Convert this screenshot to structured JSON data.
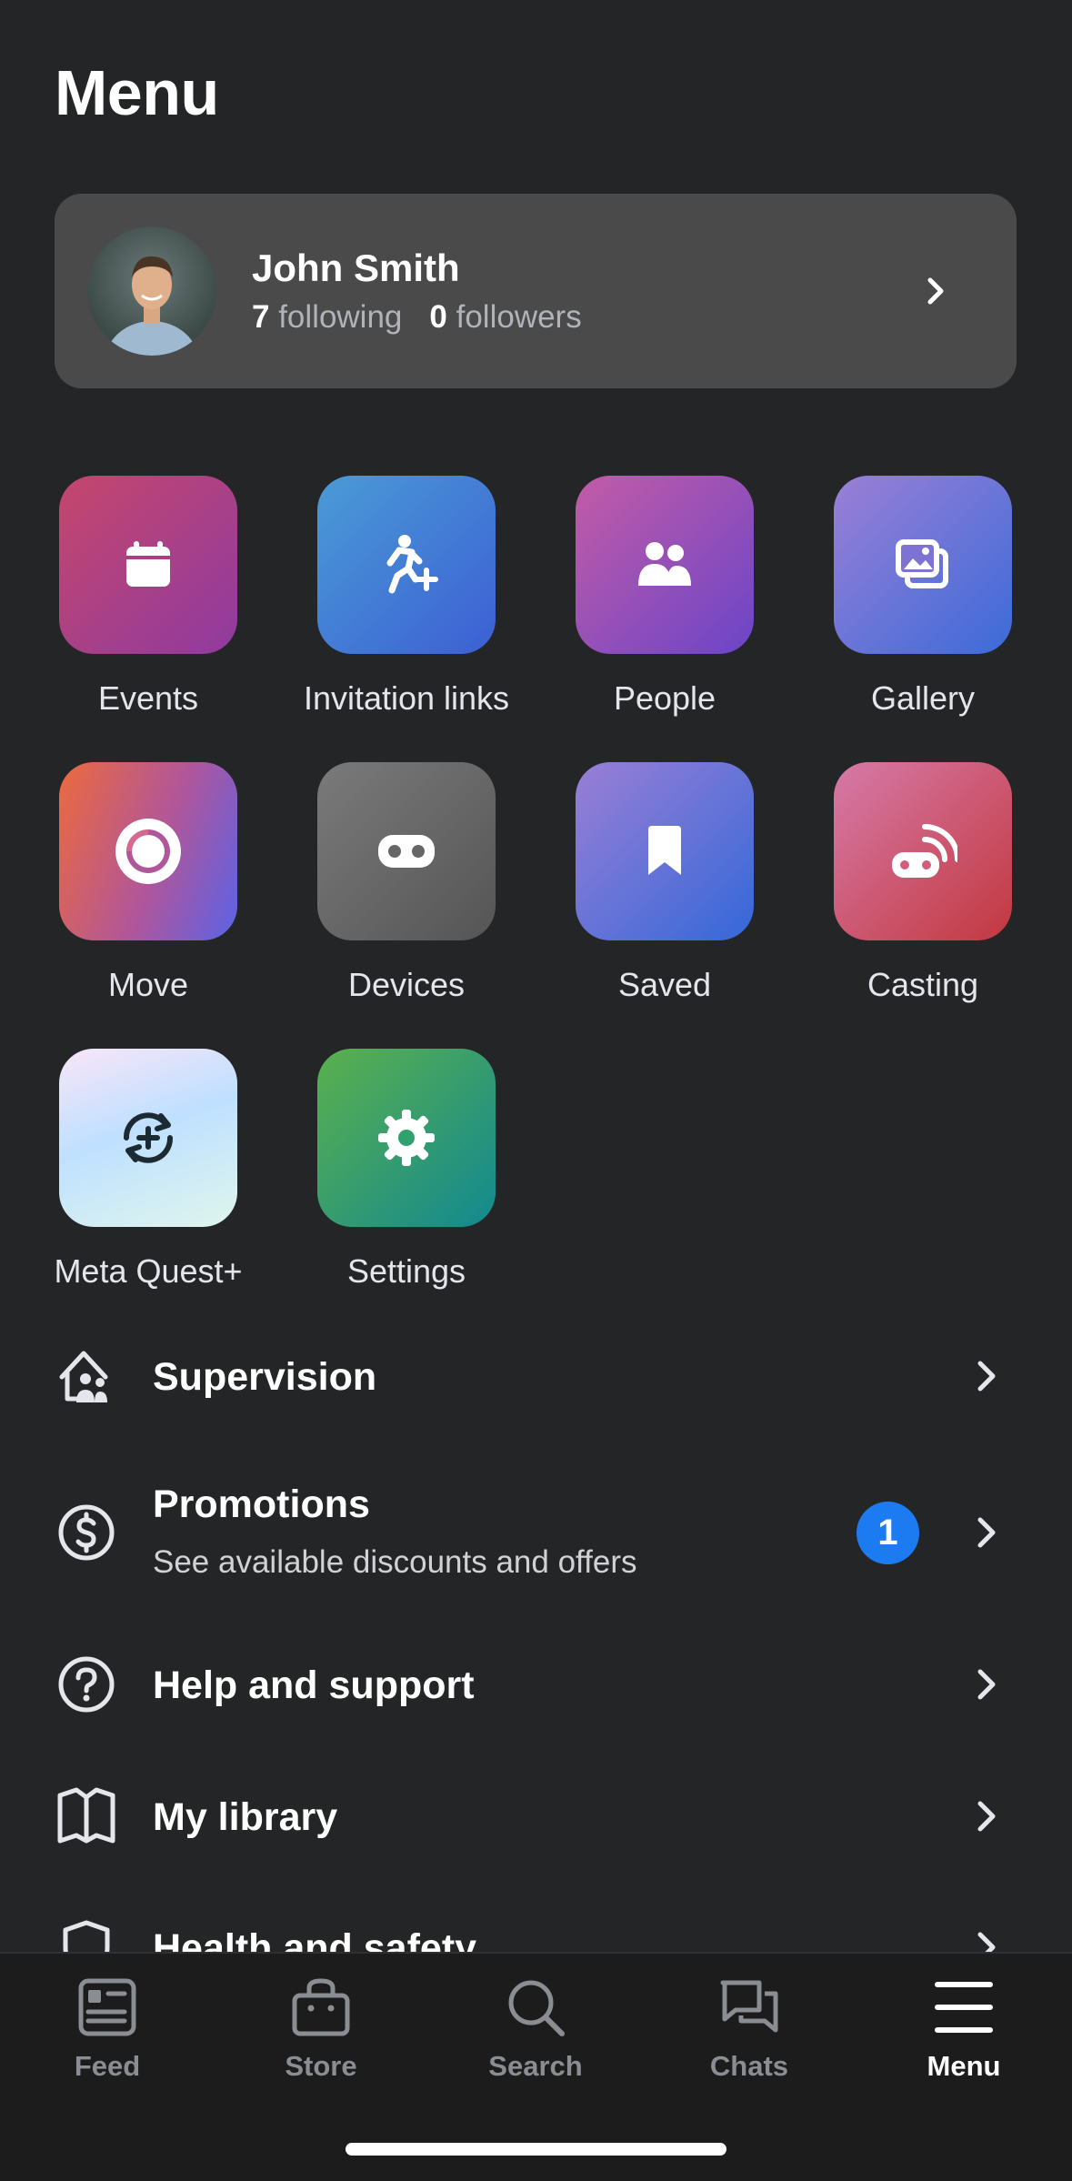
{
  "header": {
    "title": "Menu"
  },
  "profile": {
    "name": "John Smith",
    "following_count": "7",
    "following_label": "following",
    "followers_count": "0",
    "followers_label": "followers"
  },
  "grid": [
    {
      "label": "Events",
      "icon": "calendar-icon"
    },
    {
      "label": "Invitation links",
      "icon": "person-add-icon"
    },
    {
      "label": "People",
      "icon": "people-icon"
    },
    {
      "label": "Gallery",
      "icon": "gallery-icon"
    },
    {
      "label": "Move",
      "icon": "move-ring-icon"
    },
    {
      "label": "Devices",
      "icon": "headset-icon"
    },
    {
      "label": "Saved",
      "icon": "bookmark-icon"
    },
    {
      "label": "Casting",
      "icon": "casting-icon"
    },
    {
      "label": "Meta Quest+",
      "icon": "quest-plus-icon"
    },
    {
      "label": "Settings",
      "icon": "gear-icon"
    }
  ],
  "list": {
    "supervision": {
      "title": "Supervision",
      "icon": "home-people-icon"
    },
    "promotions": {
      "title": "Promotions",
      "subtitle": "See available discounts and offers",
      "badge": "1",
      "icon": "dollar-circle-icon"
    },
    "help": {
      "title": "Help and support",
      "icon": "question-circle-icon"
    },
    "library": {
      "title": "My library",
      "icon": "book-icon"
    },
    "partial": {
      "title": "Health and safety"
    }
  },
  "tabs": [
    {
      "label": "Feed",
      "icon": "feed-icon",
      "active": false
    },
    {
      "label": "Store",
      "icon": "store-bag-icon",
      "active": false
    },
    {
      "label": "Search",
      "icon": "search-icon",
      "active": false
    },
    {
      "label": "Chats",
      "icon": "chats-icon",
      "active": false
    },
    {
      "label": "Menu",
      "icon": "hamburger-menu-icon",
      "active": true
    }
  ],
  "colors": {
    "background": "#242526",
    "card": "#4a4a4b",
    "badge": "#1d7bf2",
    "tabbar": "#1c1c1d"
  }
}
